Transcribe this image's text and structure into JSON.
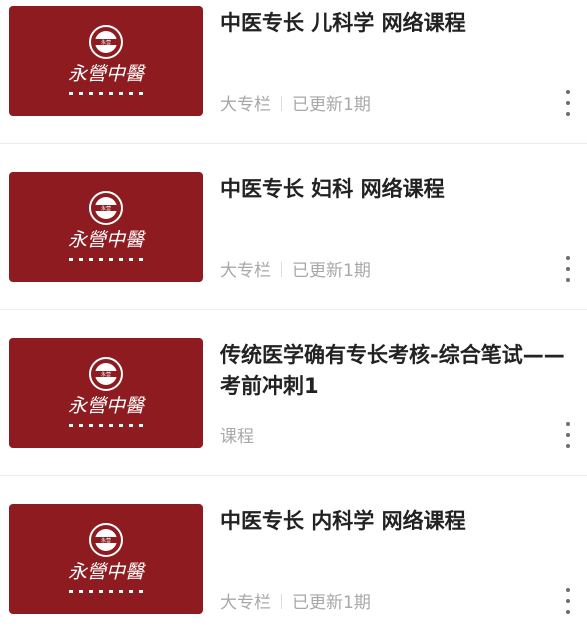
{
  "courses": [
    {
      "title": "中医专长  儿科学  网络课程",
      "type": "大专栏",
      "update": "已更新1期",
      "thumb_text": "永營中醫"
    },
    {
      "title": "中医专长  妇科  网络课程",
      "type": "大专栏",
      "update": "已更新1期",
      "thumb_text": "永營中醫"
    },
    {
      "title": "传统医学确有专长考核-综合笔试——考前冲刺1",
      "type": "课程",
      "update": "",
      "thumb_text": "永營中醫"
    },
    {
      "title": "中医专长  内科学  网络课程",
      "type": "大专栏",
      "update": "已更新1期",
      "thumb_text": "永營中醫"
    }
  ],
  "colors": {
    "thumb_bg": "#8e1b1f",
    "title": "#222222",
    "meta": "#a8a8a8"
  },
  "icons": {
    "more": "more-vertical-icon",
    "logo": "yongying-logo-icon"
  }
}
